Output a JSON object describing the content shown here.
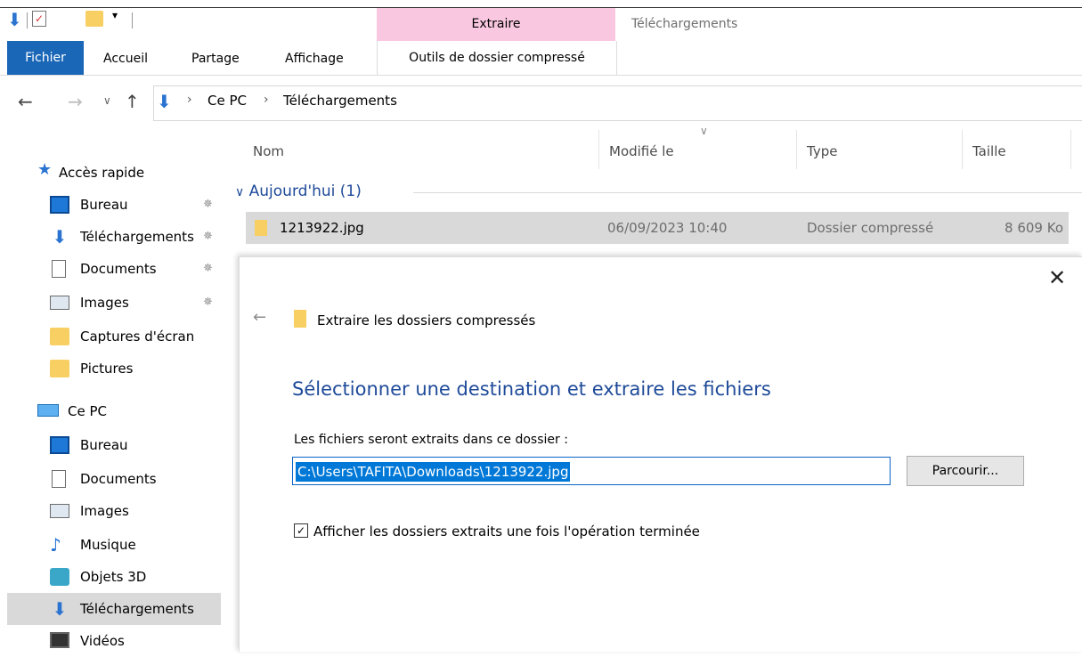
{
  "titlebar": {
    "context_tab": "Extraire",
    "window_title": "Téléchargements"
  },
  "ribbon": {
    "tabs": [
      "Fichier",
      "Accueil",
      "Partage",
      "Affichage"
    ],
    "context_tab": "Outils de dossier compressé"
  },
  "address": {
    "crumbs": [
      "Ce PC",
      "Téléchargements"
    ]
  },
  "sidebar": {
    "quick_access": "Accès rapide",
    "quick_items": [
      "Bureau",
      "Téléchargements",
      "Documents",
      "Images",
      "Captures d'écran",
      "Pictures"
    ],
    "this_pc": "Ce PC",
    "pc_items": [
      "Bureau",
      "Documents",
      "Images",
      "Musique",
      "Objets 3D",
      "Téléchargements",
      "Vidéos"
    ]
  },
  "filelist": {
    "columns": [
      "Nom",
      "Modifié le",
      "Type",
      "Taille"
    ],
    "group": "Aujourd'hui (1)",
    "rows": [
      {
        "name": "1213922.jpg",
        "modified": "06/09/2023 10:40",
        "type": "Dossier compressé",
        "size": "8 609 Ko"
      }
    ]
  },
  "dialog": {
    "title": "Extraire les dossiers compressés",
    "heading": "Sélectionner une destination et extraire les fichiers",
    "label": "Les fichiers seront extraits dans ce dossier :",
    "path": "C:\\Users\\TAFITA\\Downloads\\1213922.jpg",
    "browse": "Parcourir...",
    "checkbox_label": "Afficher les dossiers extraits une fois l'opération terminée",
    "checkbox_checked": true
  },
  "colors": {
    "accent": "#1a66b7",
    "context_tab": "#f9c7e0",
    "heading": "#1e4a99",
    "selection": "#0078d7"
  }
}
